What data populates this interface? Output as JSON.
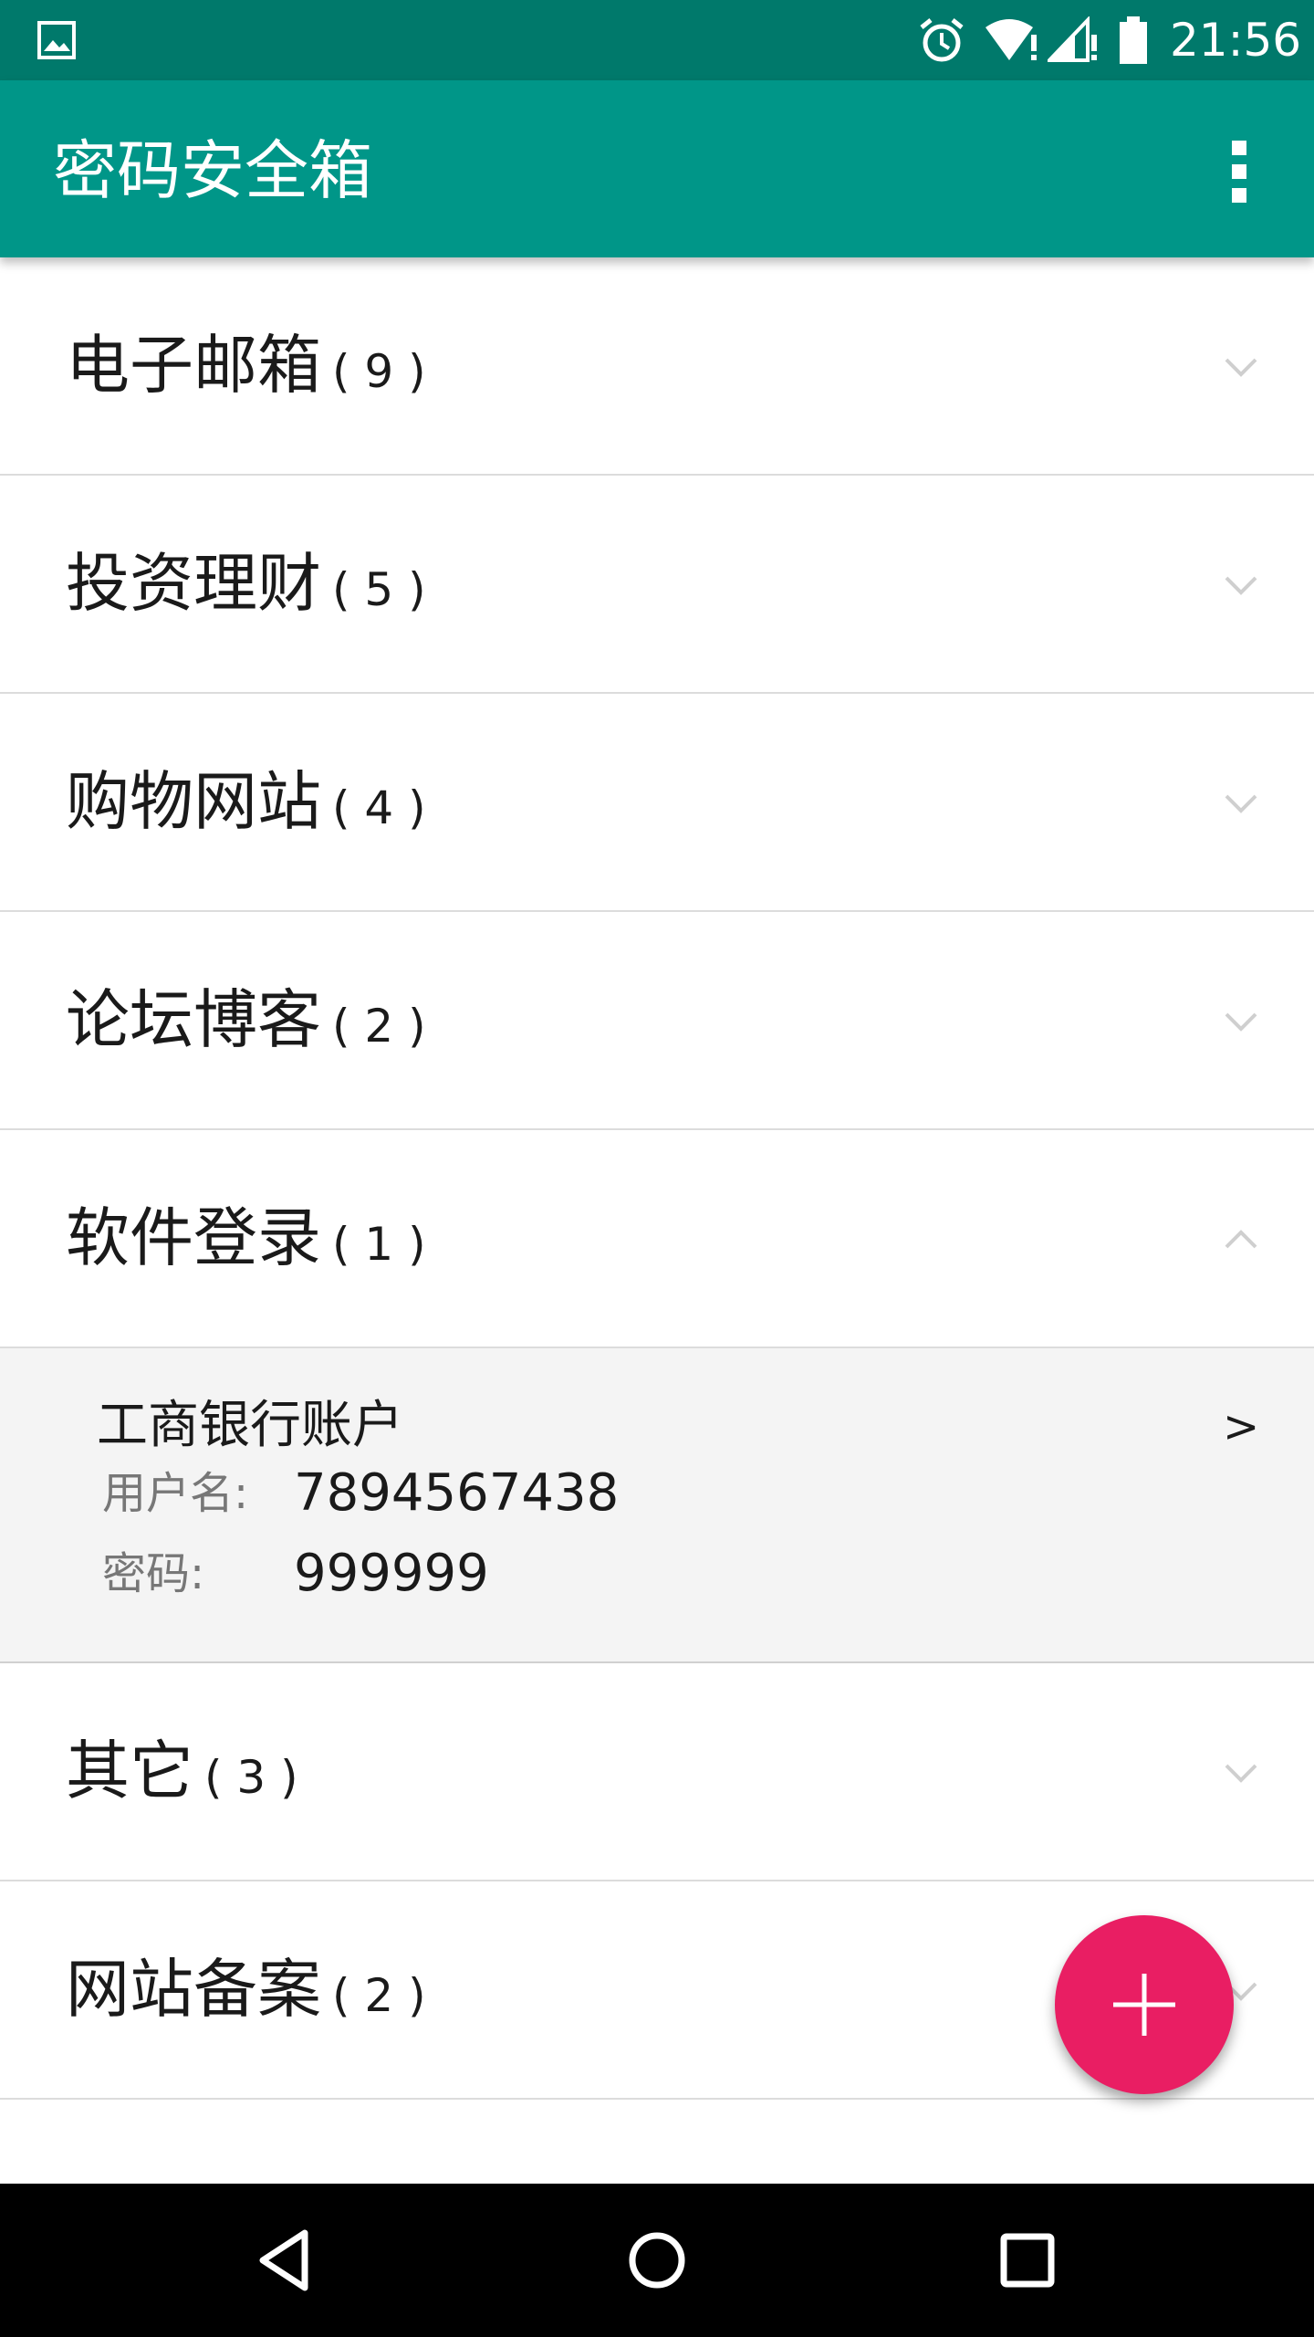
{
  "status_bar": {
    "time": "21:56",
    "icons": [
      "gallery-icon",
      "alarm-icon",
      "wifi-icon",
      "signal-icon",
      "battery-icon"
    ]
  },
  "app_bar": {
    "title": "密码安全箱",
    "overflow_icon": "overflow-menu-icon"
  },
  "colors": {
    "status_bar": "#00796b",
    "app_bar": "#009688",
    "fab": "#e91e63",
    "divider": "#dcdcdc",
    "expanded_child_bg": "#f4f4f4"
  },
  "groups": [
    {
      "label": "电子邮箱",
      "count": "( 9 )",
      "expanded": false
    },
    {
      "label": "投资理财",
      "count": "( 5 )",
      "expanded": false
    },
    {
      "label": "购物网站",
      "count": "( 4 )",
      "expanded": false
    },
    {
      "label": "论坛博客",
      "count": "( 2 )",
      "expanded": false
    },
    {
      "label": "软件登录",
      "count": "( 1 )",
      "expanded": true
    },
    {
      "label": "其它",
      "count": "( 3 )",
      "expanded": false
    },
    {
      "label": "网站备案",
      "count": "( 2 )",
      "expanded": false
    }
  ],
  "expanded_entry": {
    "name": "工商银行账户",
    "arrow": ">",
    "username_label": "用户名:",
    "username_value": "7894567438",
    "password_label": "密码:",
    "password_value": "999999"
  },
  "fab": {
    "icon": "plus-icon"
  },
  "nav_bar": {
    "icons": [
      "back-icon",
      "home-icon",
      "recents-icon"
    ]
  }
}
